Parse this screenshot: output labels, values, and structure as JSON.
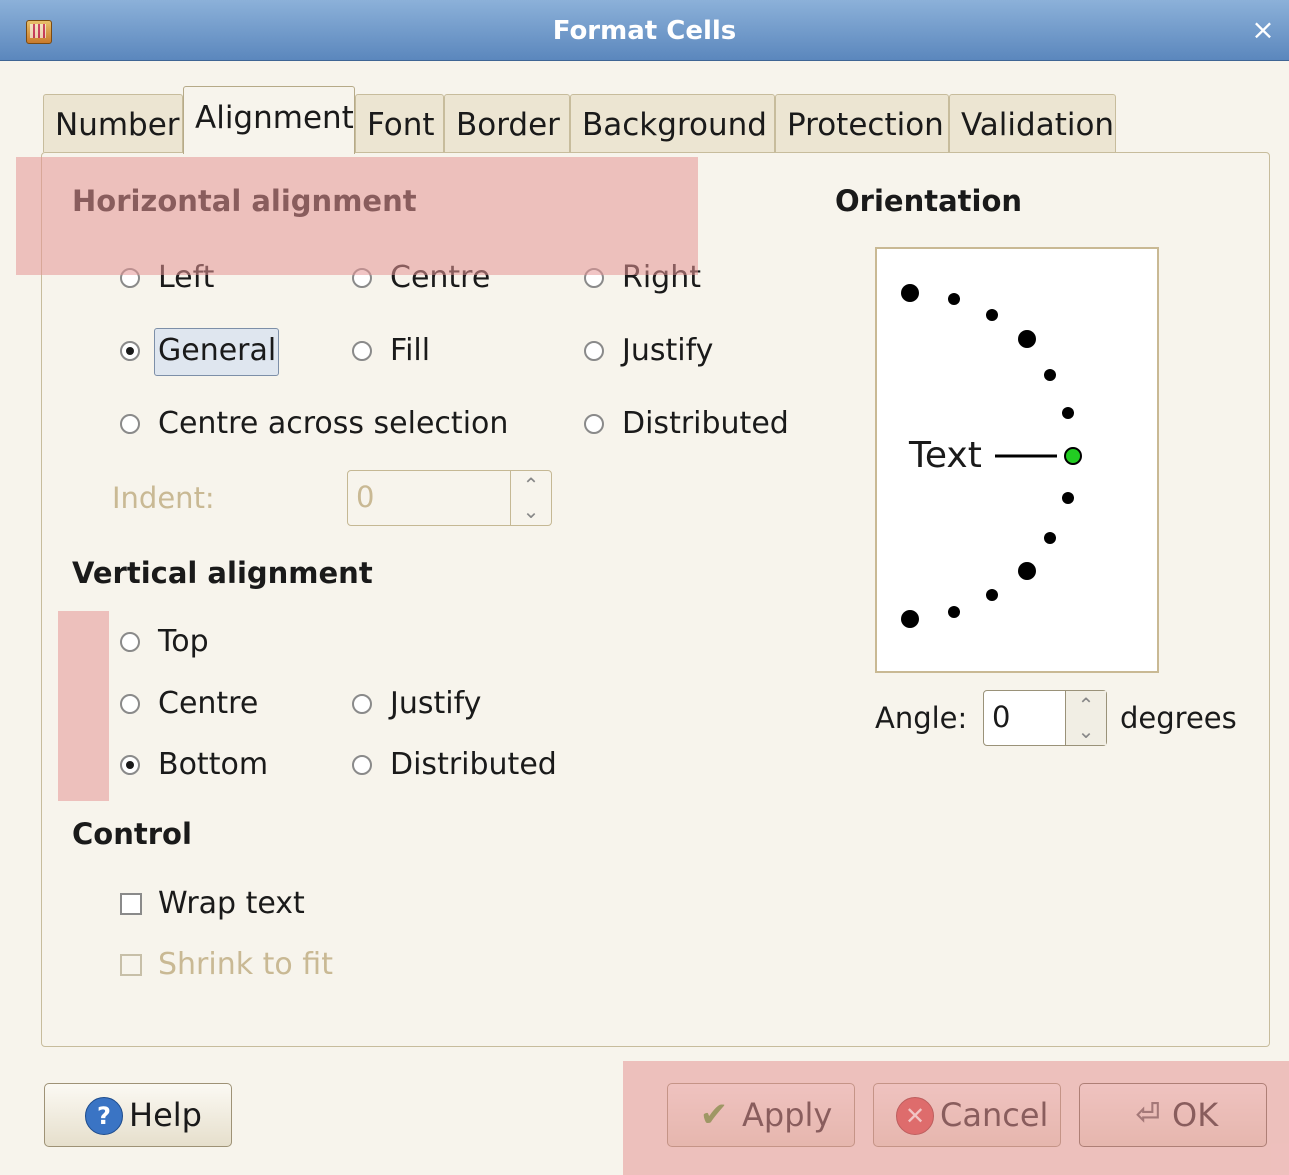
{
  "window": {
    "title": "Format Cells",
    "close_glyph": "×"
  },
  "tabs": [
    {
      "label": "Number",
      "active": false
    },
    {
      "label": "Alignment",
      "active": true
    },
    {
      "label": "Font",
      "active": false
    },
    {
      "label": "Border",
      "active": false
    },
    {
      "label": "Background",
      "active": false
    },
    {
      "label": "Protection",
      "active": false
    },
    {
      "label": "Validation",
      "active": false
    }
  ],
  "horizontal": {
    "heading": "Horizontal alignment",
    "options": [
      "Left",
      "Centre",
      "Right",
      "General",
      "Fill",
      "Justify",
      "Centre across selection",
      "Distributed"
    ],
    "selected": "General",
    "indent_label": "Indent:",
    "indent_value": "0"
  },
  "vertical": {
    "heading": "Vertical alignment",
    "options": [
      "Top",
      "Centre",
      "Justify",
      "Bottom",
      "Distributed"
    ],
    "selected": "Bottom"
  },
  "control": {
    "heading": "Control",
    "wrap_text": "Wrap text",
    "shrink_to_fit": "Shrink to fit"
  },
  "orientation": {
    "heading": "Orientation",
    "preview_text": "Text",
    "angle_label": "Angle:",
    "angle_value": "0",
    "angle_unit": "degrees"
  },
  "buttons": {
    "help": "Help",
    "apply": "Apply",
    "cancel": "Cancel",
    "ok": "OK"
  },
  "colors": {
    "titlebar": "#6f98c9",
    "dial_selected": "#22cc22",
    "highlight": "#e69696"
  }
}
